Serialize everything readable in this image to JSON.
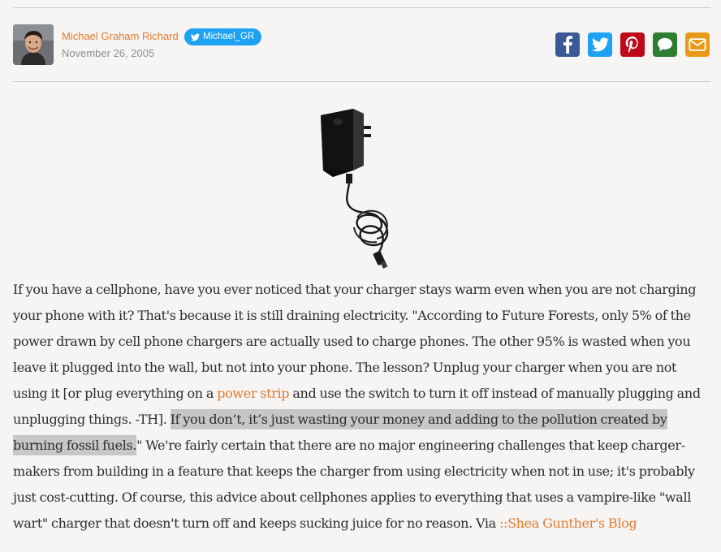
{
  "byline": {
    "author": "Michael Graham Richard",
    "twitter_handle": "Michael_GR",
    "date": "November 26, 2005"
  },
  "share": {
    "icons": [
      "facebook-icon",
      "twitter-icon",
      "pinterest-icon",
      "comment-icon",
      "email-icon"
    ],
    "colors": {
      "facebook": "#3b5998",
      "twitter": "#1da1f2",
      "pinterest": "#bd081c",
      "comment": "#2e7d32",
      "email": "#e89a17"
    }
  },
  "figure": {
    "icon": "wall-charger-image"
  },
  "article": {
    "p1": "If you have a cellphone, have you ever noticed that your charger stays warm even when you are not charging your phone with it? That's because it is still draining electricity. \"According to Future Forests, only 5% of the power drawn by cell phone chargers are actually used to charge phones. The other 95% is wasted when you leave it plugged into the wall, but not into your phone. The lesson? Unplug your charger when you are not using it [or plug everything on a ",
    "link1": "power strip",
    "p2": " and use the switch to turn it off instead of manually plugging and unplugging things. -TH]. ",
    "highlight": "If you don’t, it’s just wasting your money and adding to the pollution created by burning fossil fuels.",
    "p3": "\" We're fairly certain that there are no major engineering challenges that keep charger-makers from building in a feature that keeps the charger from using electricity when not in use; it's probably just cost-cutting. Of course, this advice about cellphones applies to everything that uses a vampire-like \"wall wart\" charger that doesn't turn off and keeps sucking juice for no reason. Via ",
    "link2": "::Shea Gunther's Blog"
  },
  "colors": {
    "accent": "#e17a2f",
    "highlight_bg": "#c8c6c6",
    "page_bg": "#f7f5f4"
  }
}
